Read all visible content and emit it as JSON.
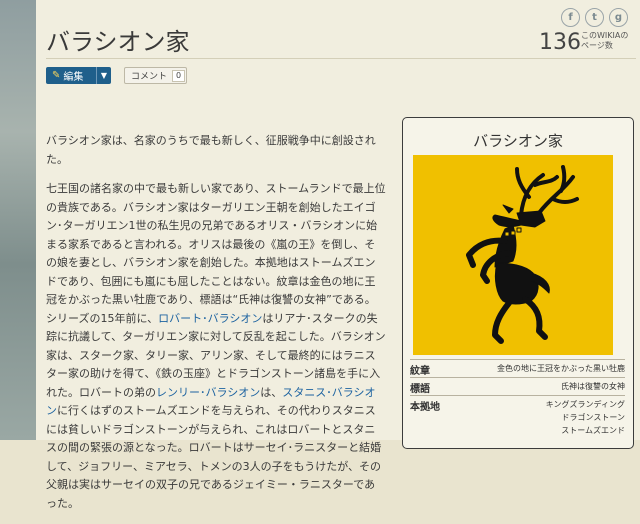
{
  "page": {
    "title": "バラシオン家",
    "social": {
      "facebook": "f",
      "twitter": "t",
      "google": "g"
    },
    "page_count": "136",
    "page_count_label_1": "このWIKIAの",
    "page_count_label_2": "ページ数"
  },
  "toolbar": {
    "edit_label": "編集",
    "comment_label": "コメント",
    "comment_count": "0"
  },
  "article": {
    "p1": "バラシオン家は、名家のうちで最も新しく、征服戦争中に創設された。",
    "p2a": "七王国の諸名家の中で最も新しい家であり、ストームランドで最上位の貴族である。バラシオン家はターガリエン王朝を創始したエイゴン･ターガリエン1世の私生児の兄弟であるオリス・バラシオンに始まる家系であると言われる。オリスは最後の《嵐の王》を倒し、その娘を妻とし、バラシオン家を創始した。本拠地はストームズエンドであり、包囲にも嵐にも屈したことはない。紋章は金色の地に王冠をかぶった黒い牡鹿であり、標語は“氏神は復讐の女神”である。シリーズの15年前に、",
    "link1": "ロバート･バラシオン",
    "p2b": "はリアナ･スタークの失踪に抗議して、ターガリエン家に対して反乱を起こした。バラシオン家は、スターク家、タリー家、アリン家、そして最終的にはラニスター家の助けを得て、《鉄の玉座》とドラゴンストーン諸島を手に入れた。ロバートの弟の",
    "link2": "レンリー･バラシオン",
    "p2c": "は、",
    "link3": "スタニス･バラシオン",
    "p2d": "に行くはずのストームズエンドを与えられ、その代わりスタニスには貧しいドラゴンストーンが与えられ、これはロバートとスタニスの間の緊張の源となった。ロバートはサーセイ･ラニスターと結婚して、ジョフリー、ミアセラ、トメンの3人の子をもうけたが、その父親は実はサーセイの双子の兄であるジェイミー・ラニスターであった。"
  },
  "infobox": {
    "title": "バラシオン家",
    "rows": [
      {
        "key": "紋章",
        "value": "金色の地に王冠をかぶった黒い牡鹿"
      },
      {
        "key": "標語",
        "value": "氏神は復讐の女神"
      },
      {
        "key": "本拠地",
        "value": "キングズランディング\nドラゴンストーン\nストームズエンド"
      }
    ],
    "colors": {
      "field": "#f0c000",
      "stag": "#111111"
    }
  }
}
